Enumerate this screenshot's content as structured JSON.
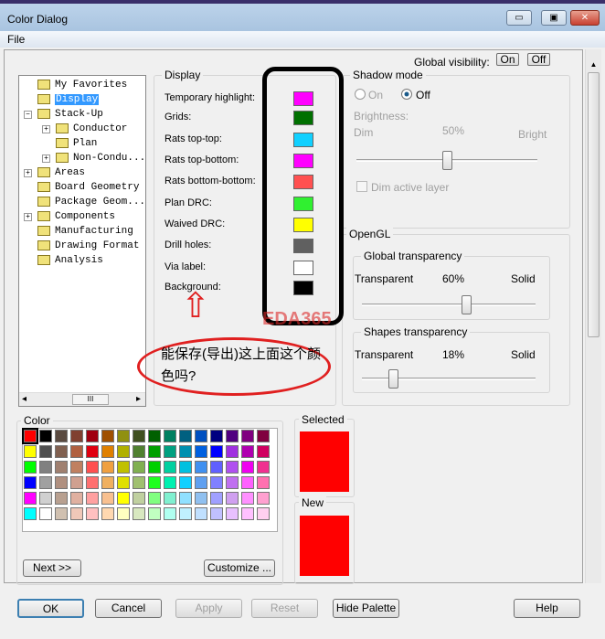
{
  "window": {
    "title": "Color Dialog",
    "minimize": "▭",
    "maximize": "▣",
    "close": "✕"
  },
  "menu": {
    "file": "File"
  },
  "global_visibility": {
    "label": "Global visibility:",
    "on": "On",
    "off": "Off"
  },
  "tree": [
    {
      "label": "My Favorites",
      "level": 1,
      "expander": ""
    },
    {
      "label": "Display",
      "level": 1,
      "expander": "",
      "selected": true
    },
    {
      "label": "Stack-Up",
      "level": 1,
      "expander": "−"
    },
    {
      "label": "Conductor",
      "level": 2,
      "expander": "+"
    },
    {
      "label": "Plan",
      "level": 2,
      "expander": ""
    },
    {
      "label": "Non-Condu...",
      "level": 2,
      "expander": "+"
    },
    {
      "label": "Areas",
      "level": 1,
      "expander": "+"
    },
    {
      "label": "Board Geometry",
      "level": 1,
      "expander": ""
    },
    {
      "label": "Package Geom...",
      "level": 1,
      "expander": ""
    },
    {
      "label": "Components",
      "level": 1,
      "expander": "+"
    },
    {
      "label": "Manufacturing",
      "level": 1,
      "expander": ""
    },
    {
      "label": "Drawing Format",
      "level": 1,
      "expander": ""
    },
    {
      "label": "Analysis",
      "level": 1,
      "expander": ""
    }
  ],
  "tree_scroll": {
    "left": "◂",
    "thumb": "III",
    "right": "▸"
  },
  "display": {
    "title": "Display",
    "items": [
      {
        "label": "Temporary highlight:",
        "color": "#ff00ff"
      },
      {
        "label": "Grids:",
        "color": "#007000"
      },
      {
        "label": "Rats top-top:",
        "color": "#10d0ff"
      },
      {
        "label": "Rats top-bottom:",
        "color": "#ff00ff"
      },
      {
        "label": "Rats bottom-bottom:",
        "color": "#ff5050"
      },
      {
        "label": "Plan DRC:",
        "color": "#30f030"
      },
      {
        "label": "Waived DRC:",
        "color": "#ffff00"
      },
      {
        "label": "Drill holes:",
        "color": "#606060"
      },
      {
        "label": "Via label:",
        "color": "#ffffff"
      },
      {
        "label": "Background:",
        "color": "#000000"
      }
    ]
  },
  "shadow": {
    "title": "Shadow mode",
    "on": "On",
    "off": "Off",
    "selected": "Off",
    "brightness": "Brightness:",
    "dim": "Dim",
    "value": "50%",
    "bright": "Bright",
    "level": 50,
    "dim_active": "Dim active layer",
    "dim_active_checked": false
  },
  "opengl": {
    "title": "OpenGL",
    "global": {
      "title": "Global transparency",
      "left": "Transparent",
      "value": "60%",
      "right": "Solid",
      "level": 60
    },
    "shapes": {
      "title": "Shapes transparency",
      "left": "Transparent",
      "value": "18%",
      "right": "Solid",
      "level": 18
    }
  },
  "color": {
    "title": "Color",
    "next": "Next >>",
    "customize": "Customize ...",
    "palette": [
      [
        "#ff0000",
        "#000000",
        "#5a4a40",
        "#804030",
        "#a00010",
        "#a05000",
        "#909010",
        "#405020",
        "#006000",
        "#008060",
        "#006080",
        "#0050c0",
        "#000080",
        "#500080",
        "#800080",
        "#800040"
      ],
      [
        "#ffff00",
        "#505050",
        "#806050",
        "#b06040",
        "#e00010",
        "#e08000",
        "#b0b000",
        "#508030",
        "#00a000",
        "#00a080",
        "#0090b0",
        "#0060e0",
        "#0000ff",
        "#a030e0",
        "#b000b0",
        "#d00060"
      ],
      [
        "#00ff00",
        "#808080",
        "#a08070",
        "#c08060",
        "#ff5050",
        "#f0a040",
        "#c0c000",
        "#80b050",
        "#00d000",
        "#00d0a0",
        "#00c0e0",
        "#4090f0",
        "#6060ff",
        "#b050f0",
        "#f000f0",
        "#f03090"
      ],
      [
        "#0000ff",
        "#a0a0a0",
        "#b09080",
        "#d0a090",
        "#ff7070",
        "#f0b060",
        "#e0e000",
        "#a0c070",
        "#20ff20",
        "#00f0b0",
        "#10d0ff",
        "#60a0f0",
        "#8080ff",
        "#c070f0",
        "#ff60ff",
        "#ff70b0"
      ],
      [
        "#ff00ff",
        "#d0d0d0",
        "#b8a090",
        "#e0b0a0",
        "#ffa0a0",
        "#f8c090",
        "#ffff00",
        "#c0d0a0",
        "#80ff80",
        "#80f0d0",
        "#90e0ff",
        "#90c0f0",
        "#a0a0ff",
        "#d0a0f0",
        "#ff90ff",
        "#ffa0d0"
      ],
      [
        "#00ffff",
        "#ffffff",
        "#d0c0b0",
        "#f0c8b8",
        "#ffc0c0",
        "#ffd8b0",
        "#ffffc0",
        "#d8e8c0",
        "#c0ffc0",
        "#b0fff0",
        "#c0f0ff",
        "#c0e0ff",
        "#c0c0ff",
        "#e8c0ff",
        "#ffc0ff",
        "#ffd0f0"
      ]
    ]
  },
  "selected": {
    "title": "Selected",
    "color": "#ff0000"
  },
  "new": {
    "title": "New",
    "color": "#ff0000"
  },
  "buttons": {
    "ok": "OK",
    "cancel": "Cancel",
    "apply": "Apply",
    "reset": "Reset",
    "hide_palette": "Hide Palette",
    "help": "Help"
  },
  "annotation": {
    "question": "能保存(导出)这上面这个颜色吗?",
    "watermark": "EDA365",
    "arrow": "⇧"
  }
}
